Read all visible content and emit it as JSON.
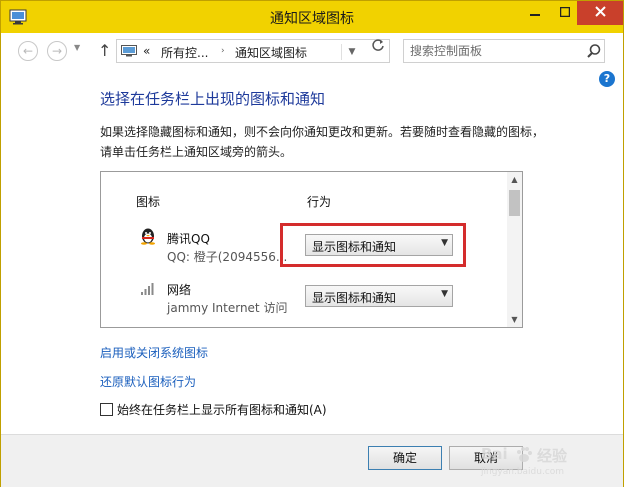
{
  "window": {
    "title": "通知区域图标"
  },
  "nav": {
    "breadcrumb_prefix": "«",
    "crumbs": [
      "所有控...",
      "通知区域图标"
    ],
    "crumb_separator": "›",
    "search_placeholder": "搜索控制面板"
  },
  "help_label": "?",
  "main": {
    "heading": "选择在任务栏上出现的图标和通知",
    "description": "如果选择隐藏图标和通知，则不会向你通知更改和更新。若要随时查看隐藏的图标，请单击任务栏上通知区域旁的箭头。",
    "column_icon": "图标",
    "column_behavior": "行为",
    "rows": [
      {
        "name": "腾讯QQ",
        "detail": "QQ: 橙子(2094556...",
        "behavior": "显示图标和通知",
        "icon": "qq-penguin-icon"
      },
      {
        "name": "网络",
        "detail": "jammy Internet 访问",
        "behavior": "显示图标和通知",
        "icon": "network-signal-icon"
      }
    ],
    "links": [
      "启用或关闭系统图标",
      "还原默认图标行为"
    ],
    "always_show_label": "始终在任务栏上显示所有图标和通知(A)",
    "always_show_checked": false
  },
  "footer": {
    "ok_label": "确定",
    "cancel_label": "取消"
  },
  "watermark": {
    "text_1": "Bai",
    "text_2": "经验",
    "text_3": "jingyan.baidu.com"
  },
  "colors": {
    "titlebar": "#f1d200",
    "heading": "#1e3a9b",
    "link": "#1b5fbd",
    "highlight": "#d42c2c"
  }
}
